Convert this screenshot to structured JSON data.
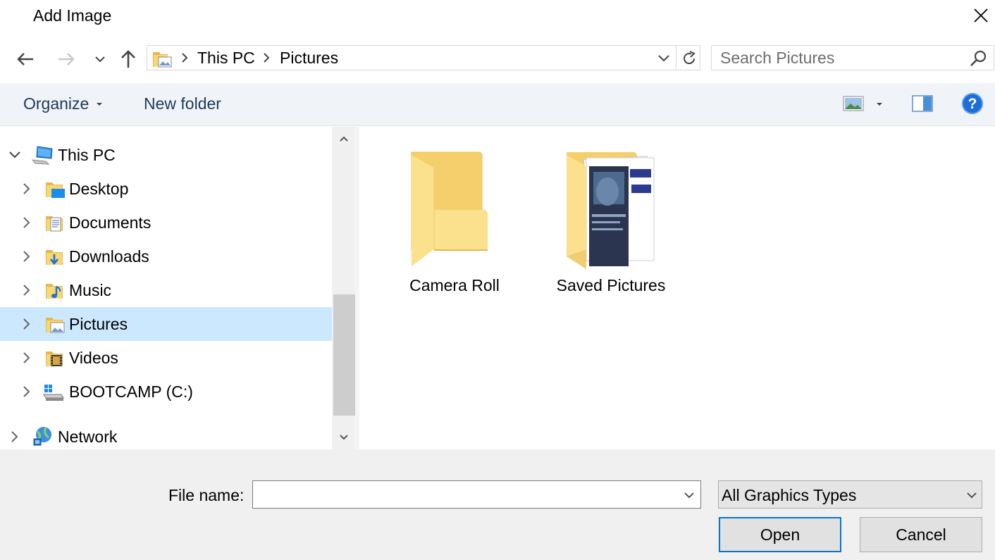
{
  "window": {
    "title": "Add Image"
  },
  "address": {
    "crumbs": [
      "This PC",
      "Pictures"
    ]
  },
  "search": {
    "placeholder": "Search Pictures"
  },
  "toolbar": {
    "organize_label": "Organize",
    "new_folder_label": "New folder"
  },
  "nav_tree": {
    "items": [
      {
        "label": "This PC",
        "icon": "computer-icon",
        "expanded": true,
        "level": 0
      },
      {
        "label": "Desktop",
        "icon": "desktop-folder-icon",
        "level": 1
      },
      {
        "label": "Documents",
        "icon": "documents-folder-icon",
        "level": 1
      },
      {
        "label": "Downloads",
        "icon": "downloads-folder-icon",
        "level": 1
      },
      {
        "label": "Music",
        "icon": "music-folder-icon",
        "level": 1
      },
      {
        "label": "Pictures",
        "icon": "pictures-folder-icon",
        "level": 1,
        "selected": true
      },
      {
        "label": "Videos",
        "icon": "videos-folder-icon",
        "level": 1
      },
      {
        "label": "BOOTCAMP (C:)",
        "icon": "drive-icon",
        "level": 1
      },
      {
        "label": "Network",
        "icon": "network-icon",
        "level": 0
      }
    ]
  },
  "content": {
    "items": [
      {
        "label": "Camera Roll",
        "icon": "folder-icon"
      },
      {
        "label": "Saved Pictures",
        "icon": "folder-with-image-icon"
      }
    ]
  },
  "bottom": {
    "file_name_label": "File name:",
    "file_name_value": "",
    "file_type_selected": "All Graphics Types",
    "open_label": "Open",
    "cancel_label": "Cancel"
  },
  "colors": {
    "selection": "#cce8ff",
    "accent": "#0078d7",
    "command_bar": "#f0f4f9",
    "folder": "#f8d775"
  }
}
